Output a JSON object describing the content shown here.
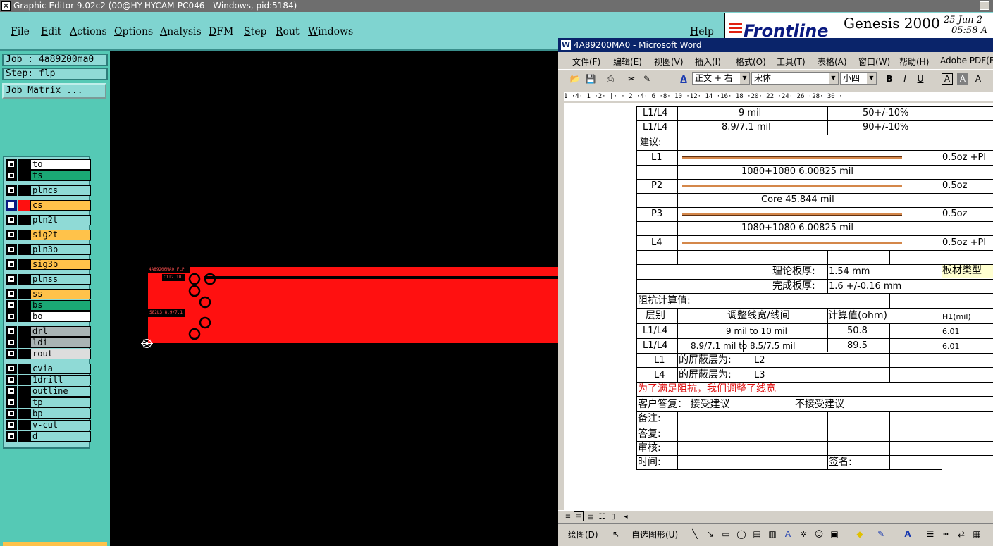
{
  "genesis": {
    "title": "Graphic Editor 9.02c2 (00@HY-HYCAM-PC046 - Windows, pid:5184)",
    "menu": [
      "File",
      "Edit",
      "Actions",
      "Options",
      "Analysis",
      "DFM",
      "Step",
      "Rout",
      "Windows",
      "Help"
    ],
    "brand": {
      "logo": "Frontline",
      "product": "Genesis 2000",
      "date": "25 Jun 2",
      "time": "05:58 A"
    },
    "job": "Job : 4a89200ma0",
    "step": "Step: flp",
    "job_matrix_button": "Job Matrix ...",
    "layers": [
      {
        "name": "to",
        "color": "#ffffff"
      },
      {
        "name": "ts",
        "color": "#1aa875"
      },
      {
        "name": "plncs",
        "color": "#8fdad6"
      },
      {
        "name": "cs",
        "color": "#ffc24a",
        "active": true
      },
      {
        "name": "pln2t",
        "color": "#8fdad6"
      },
      {
        "name": "sig2t",
        "color": "#ffc24a"
      },
      {
        "name": "pln3b",
        "color": "#8fdad6"
      },
      {
        "name": "sig3b",
        "color": "#ffc24a"
      },
      {
        "name": "plnss",
        "color": "#8fdad6"
      },
      {
        "name": "ss",
        "color": "#ffc24a"
      },
      {
        "name": "bs",
        "color": "#1aa875"
      },
      {
        "name": "bo",
        "color": "#ffffff"
      },
      {
        "name": "drl",
        "color": "#a9b4b4"
      },
      {
        "name": "ldi",
        "color": "#a9b4b4"
      },
      {
        "name": "rout",
        "color": "#dddddd"
      },
      {
        "name": "cvia",
        "color": "#8fdad6"
      },
      {
        "name": "1drill",
        "color": "#8fdad6"
      },
      {
        "name": "outline",
        "color": "#8fdad6"
      },
      {
        "name": "tp",
        "color": "#8fdad6"
      },
      {
        "name": "bp",
        "color": "#8fdad6"
      },
      {
        "name": "v-cut",
        "color": "#8fdad6"
      },
      {
        "name": "d",
        "color": "#8fdad6"
      }
    ],
    "board_labels": [
      "4A89200MA0 FLP",
      "C1I2 10",
      "S82L3 8.9/7.1"
    ]
  },
  "word": {
    "title": "4A89200MA0 - Microsoft Word",
    "menu": [
      "文件(F)",
      "编辑(E)",
      "视图(V)",
      "插入(I)",
      "格式(O)",
      "工具(T)",
      "表格(A)",
      "窗口(W)",
      "帮助(H)",
      "Adobe PDF(B)"
    ],
    "style": "正文 + 右",
    "font": "宋体",
    "size": "小四",
    "ruler": "1 ·4· 1 ·2· |·|· 2 ·4· 6 ·8· 10 ·12· 14 ·16· 18 ·20· 22 ·24· 26 ·28· 30 ·",
    "table": {
      "rows_top": [
        {
          "layer": "L1/L4",
          "width": "9 mil",
          "tol": "50+/-10%"
        },
        {
          "layer": "L1/L4",
          "width": "8.9/7.1 mil",
          "tol": "90+/-10%"
        }
      ],
      "suggest_label": "建议:",
      "stack": [
        {
          "label": "L1",
          "right": "0.5oz +Pl"
        },
        {
          "mid": "1080+1080    6.00825 mil"
        },
        {
          "label": "P2",
          "right": "0.5oz"
        },
        {
          "mid": "Core   45.844 mil"
        },
        {
          "label": "P3",
          "right": "0.5oz"
        },
        {
          "mid": "1080+1080    6.00825 mil"
        },
        {
          "label": "L4",
          "right": "0.5oz +Pl"
        }
      ],
      "thickness_label": "理论板厚:",
      "thickness_value": "1.54 mm",
      "board_type": "板材类型",
      "finished_label": "完成板厚:",
      "finished_value": "1.6 +/-0.16 mm",
      "impedance_title": "阻抗计算值:",
      "headers": {
        "layer": "层别",
        "adjust": "调整线宽/线间",
        "calc": "计算值(ohm)",
        "h1": "H1(mil)"
      },
      "imp_rows": [
        {
          "layer": "L1/L4",
          "adj": "9 mil to 10 mil",
          "calc": "50.8",
          "h1": "6.01"
        },
        {
          "layer": "L1/L4",
          "adj": "8.9/7.1 mil to 8.5/7.5 mil",
          "calc": "89.5",
          "h1": "6.01"
        }
      ],
      "shield": [
        {
          "layer": "L1",
          "text": "的屏蔽层为:",
          "val": "L2"
        },
        {
          "layer": "L4",
          "text": "的屏蔽层为:",
          "val": "L3"
        }
      ],
      "note_red": "为了满足阻抗，我们调整了线宽",
      "customer": "客户答复：  接受建议",
      "reject": "不接受建议",
      "remark": "备注:",
      "reply": "答复:",
      "review": "审核:",
      "time": "时间:",
      "sign": "签名:"
    },
    "drawbar": {
      "draw": "绘图(D)",
      "autoshape": "自选图形(U)"
    }
  },
  "colors": {
    "teal": "#7fd4d0",
    "panel": "#55c9b5",
    "board": "#ff1010",
    "word_title": "#0a246a",
    "red_text": "#e01010"
  }
}
